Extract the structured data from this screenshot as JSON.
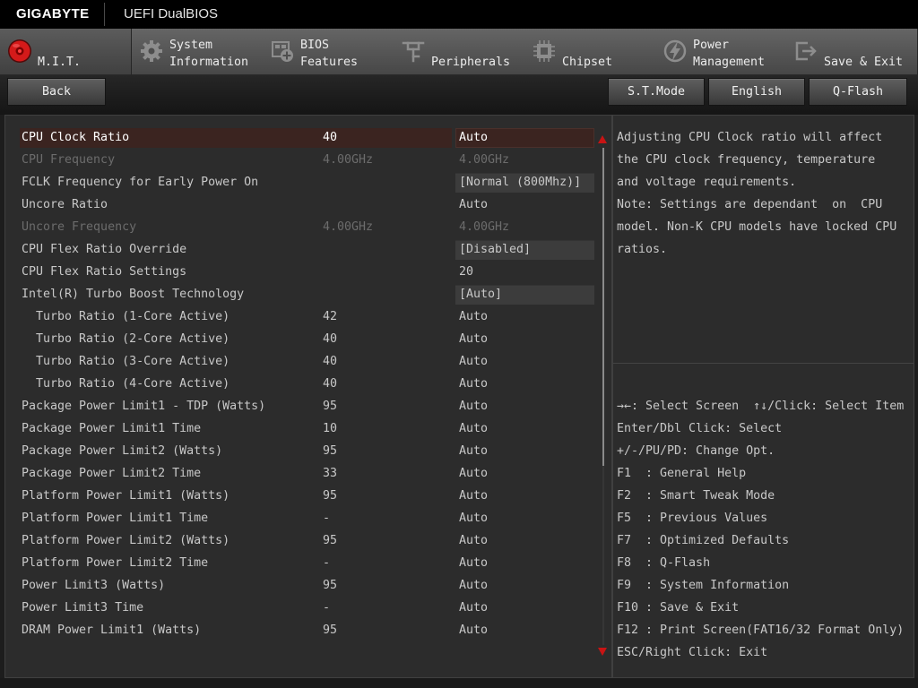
{
  "header": {
    "brand": "GIGABYTE",
    "title": "UEFI DualBIOS"
  },
  "tabs": [
    {
      "line2": "M.I.T.",
      "icon": "mit-icon",
      "active": true
    },
    {
      "line1": "System",
      "line2": "Information",
      "icon": "gear-icon",
      "active": false
    },
    {
      "line1": "BIOS",
      "line2": "Features",
      "icon": "bios-features-icon",
      "active": false
    },
    {
      "line2": "Peripherals",
      "icon": "peripherals-icon",
      "active": false
    },
    {
      "line2": "Chipset",
      "icon": "chipset-icon",
      "active": false
    },
    {
      "line1": "Power",
      "line2": "Management",
      "icon": "power-icon",
      "active": false
    },
    {
      "line2": "Save & Exit",
      "icon": "exit-icon",
      "active": false
    }
  ],
  "toolbar": {
    "back": "Back",
    "st_mode": "S.T.Mode",
    "language": "English",
    "qflash": "Q-Flash"
  },
  "settings": [
    {
      "name": "CPU Clock Ratio",
      "current": "40",
      "value": "Auto",
      "selected": true
    },
    {
      "name": "CPU Frequency",
      "current": "4.00GHz",
      "value": "4.00GHz",
      "disabled": true
    },
    {
      "name": "FCLK Frequency for Early Power On",
      "value": "[Normal (800Mhz)]",
      "dropdown": true
    },
    {
      "name": "Uncore Ratio",
      "value": "Auto"
    },
    {
      "name": "Uncore Frequency",
      "current": "4.00GHz",
      "value": "4.00GHz",
      "disabled": true
    },
    {
      "name": "CPU Flex Ratio Override",
      "value": "[Disabled]",
      "dropdown": true
    },
    {
      "name": "CPU Flex Ratio Settings",
      "value": "20"
    },
    {
      "name": "Intel(R) Turbo Boost Technology",
      "value": "[Auto]",
      "dropdown": true
    },
    {
      "name": "Turbo Ratio (1-Core Active)",
      "current": "42",
      "value": "Auto",
      "sub_item": true
    },
    {
      "name": "Turbo Ratio (2-Core Active)",
      "current": "40",
      "value": "Auto",
      "sub_item": true
    },
    {
      "name": "Turbo Ratio (3-Core Active)",
      "current": "40",
      "value": "Auto",
      "sub_item": true
    },
    {
      "name": "Turbo Ratio (4-Core Active)",
      "current": "40",
      "value": "Auto",
      "sub_item": true
    },
    {
      "name": "Package Power Limit1 - TDP (Watts)",
      "current": "95",
      "value": "Auto"
    },
    {
      "name": "Package Power Limit1 Time",
      "current": "10",
      "value": "Auto"
    },
    {
      "name": "Package Power Limit2 (Watts)",
      "current": "95",
      "value": "Auto"
    },
    {
      "name": "Package Power Limit2 Time",
      "current": "33",
      "value": "Auto"
    },
    {
      "name": "Platform Power Limit1 (Watts)",
      "current": "95",
      "value": "Auto"
    },
    {
      "name": "Platform Power Limit1 Time",
      "current": "-",
      "value": "Auto"
    },
    {
      "name": "Platform Power Limit2 (Watts)",
      "current": "95",
      "value": "Auto"
    },
    {
      "name": "Platform Power Limit2 Time",
      "current": "-",
      "value": "Auto"
    },
    {
      "name": "Power Limit3 (Watts)",
      "current": "95",
      "value": "Auto"
    },
    {
      "name": "Power Limit3 Time",
      "current": "-",
      "value": "Auto"
    },
    {
      "name": "DRAM Power Limit1 (Watts)",
      "current": "95",
      "value": "Auto"
    }
  ],
  "scrollbar": {
    "thumb_fraction": 0.64,
    "offset_fraction": 0
  },
  "help": {
    "description": [
      "Adjusting CPU Clock ratio will affect",
      "the CPU clock frequency, temperature",
      "and voltage requirements.",
      "Note: Settings are dependant  on  CPU",
      "model. Non-K CPU models have locked CPU",
      "ratios."
    ]
  },
  "keys": [
    "→←: Select Screen  ↑↓/Click: Select Item",
    "Enter/Dbl Click: Select",
    "+/-/PU/PD: Change Opt.",
    "F1  : General Help",
    "F2  : Smart Tweak Mode",
    "F5  : Previous Values",
    "F7  : Optimized Defaults",
    "F8  : Q-Flash",
    "F9  : System Information",
    "F10 : Save & Exit",
    "F12 : Print Screen(FAT16/32 Format Only)",
    "ESC/Right Click: Exit"
  ],
  "colors": {
    "text": "#c8c8c8",
    "disabled_text": "#6c6c6c",
    "selected_row": "#3b2420",
    "accent_red": "#d41a1a"
  }
}
